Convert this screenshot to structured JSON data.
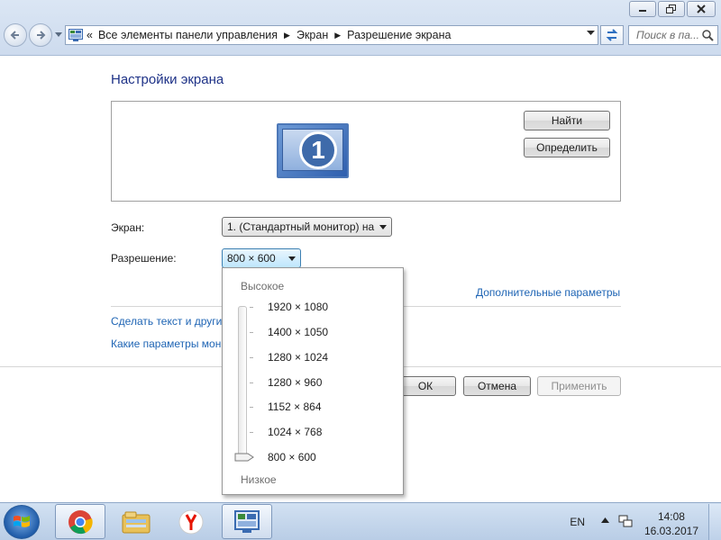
{
  "address_bar": {
    "overflow": "«",
    "crumbs": [
      "Все элементы панели управления",
      "Экран",
      "Разрешение экрана"
    ],
    "search_placeholder": "Поиск в па..."
  },
  "window_buttons": {
    "minimize_icon": "minimize-icon",
    "maximize_icon": "maximize-icon",
    "close_icon": "close-icon"
  },
  "page": {
    "title": "Настройки экрана",
    "monitor_number": "1",
    "find_button": "Найти",
    "identify_button": "Определить",
    "screen_label": "Экран:",
    "screen_value": "1. (Стандартный монитор) на",
    "resolution_label": "Разрешение:",
    "resolution_value": "800 × 600",
    "advanced_link": "Дополнительные параметры",
    "link_text_size": "Сделать текст и другие",
    "link_monitor_params": "Какие параметры мон",
    "ok_button": "ОК",
    "cancel_button": "Отмена",
    "apply_button": "Применить"
  },
  "resolution_dropdown": {
    "high_label": "Высокое",
    "low_label": "Низкое",
    "options": [
      "1920 × 1080",
      "1400 × 1050",
      "1280 × 1024",
      "1280 × 960",
      "1152 × 864",
      "1024 × 768",
      "800 × 600"
    ],
    "selected": "800 × 600"
  },
  "taskbar": {
    "apps": [
      "start-icon",
      "chrome-icon",
      "explorer-icon",
      "yandex-icon",
      "control-panel-icon"
    ],
    "language": "EN",
    "time": "14:08",
    "date": "16.03.2017"
  },
  "colors": {
    "title_blue": "#1e3287",
    "link_blue": "#1e64b4",
    "taskbar": "#c5d7ed"
  }
}
